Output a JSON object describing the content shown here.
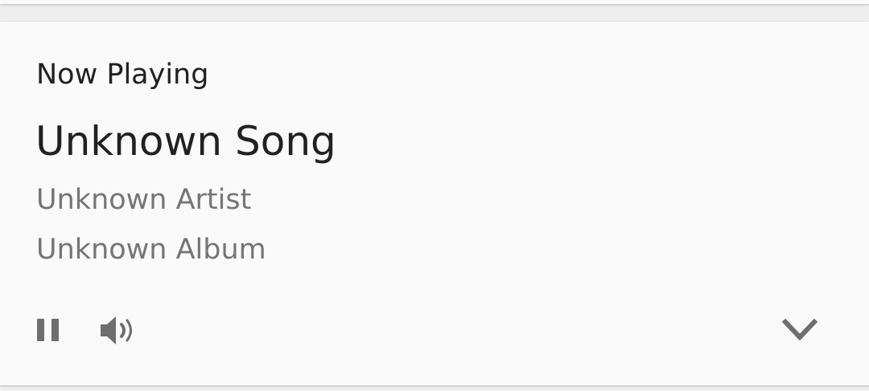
{
  "card": {
    "header": "Now Playing",
    "song_title": "Unknown Song",
    "artist": "Unknown Artist",
    "album": "Unknown Album"
  },
  "controls": {
    "pause_icon": "pause-icon",
    "volume_icon": "volume-icon",
    "expand_icon": "chevron-down-icon"
  },
  "colors": {
    "card_background": "#fafafa",
    "page_background": "#eeeeee",
    "primary_text": "#212121",
    "secondary_text": "#757575",
    "icon": "#6e6e6e"
  }
}
